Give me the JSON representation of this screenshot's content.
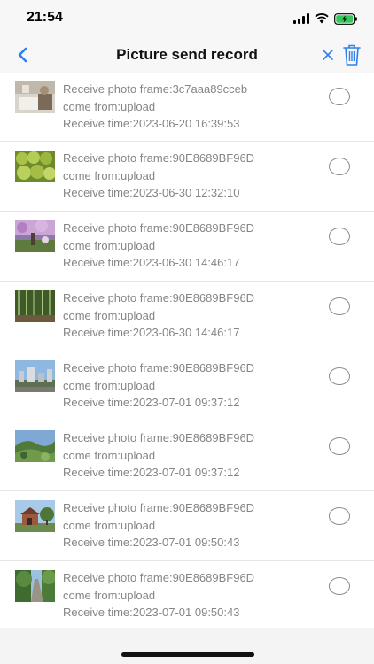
{
  "status_bar": {
    "time": "21:54"
  },
  "nav": {
    "title": "Picture send record"
  },
  "colors": {
    "accent": "#2f80ed",
    "text_gray": "#858585"
  },
  "records": [
    {
      "frame": "Receive photo frame:3c7aaa89cceb",
      "source": "come from:upload",
      "time": "Receive time:2023-06-20 16:39:53",
      "thumb": "room-photo"
    },
    {
      "frame": "Receive photo frame:90E8689BF96D",
      "source": "come from:upload",
      "time": "Receive time:2023-06-30 12:32:10",
      "thumb": "limes-photo"
    },
    {
      "frame": "Receive photo frame:90E8689BF96D",
      "source": "come from:upload",
      "time": "Receive time:2023-06-30 14:46:17",
      "thumb": "flowers-photo"
    },
    {
      "frame": "Receive photo frame:90E8689BF96D",
      "source": "come from:upload",
      "time": "Receive time:2023-06-30 14:46:17",
      "thumb": "bamboo-photo"
    },
    {
      "frame": "Receive photo frame:90E8689BF96D",
      "source": "come from:upload",
      "time": "Receive time:2023-07-01 09:37:12",
      "thumb": "city-photo"
    },
    {
      "frame": "Receive photo frame:90E8689BF96D",
      "source": "come from:upload",
      "time": "Receive time:2023-07-01 09:37:12",
      "thumb": "hills-photo"
    },
    {
      "frame": "Receive photo frame:90E8689BF96D",
      "source": "come from:upload",
      "time": "Receive time:2023-07-01 09:50:43",
      "thumb": "house-photo"
    },
    {
      "frame": "Receive photo frame:90E8689BF96D",
      "source": "come from:upload",
      "time": "Receive time:2023-07-01 09:50:43",
      "thumb": "path-photo"
    }
  ]
}
